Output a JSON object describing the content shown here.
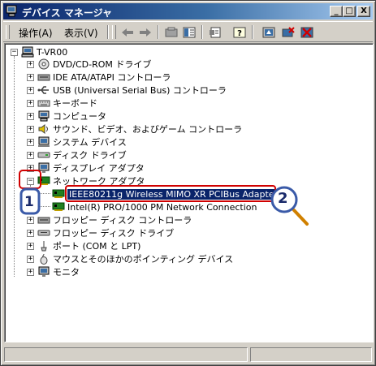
{
  "window": {
    "title": "デバイス マネージャ"
  },
  "title_buttons": {
    "minimize": "_",
    "maximize": "□",
    "close": "X"
  },
  "menu": {
    "action": "操作(A)",
    "view": "表示(V)"
  },
  "toolbar": [
    "back-icon",
    "forward-icon",
    "scan-icon",
    "properties-icon",
    "print-icon",
    "help-icon",
    "update-driver-icon",
    "uninstall-icon",
    "disable-icon"
  ],
  "tree": {
    "root": "T-VR00",
    "items": [
      "DVD/CD-ROM ドライブ",
      "IDE ATA/ATAPI コントローラ",
      "USB (Universal Serial Bus) コントローラ",
      "キーボード",
      "コンピュータ",
      "サウンド、ビデオ、およびゲーム コントローラ",
      "システム デバイス",
      "ディスク ドライブ",
      "ディスプレイ アダプタ",
      "ネットワーク アダプタ"
    ],
    "network_children": [
      "IEEE80211g Wireless MIMO XR PCIBus Adapter",
      "Intel(R) PRO/1000 PM Network Connection"
    ],
    "after_items": [
      "フロッピー ディスク コントローラ",
      "フロッピー ディスク ドライブ",
      "ポート (COM と LPT)",
      "マウスとそのほかのポインティング デバイス",
      "モニタ"
    ]
  },
  "annotations": {
    "step1": "1",
    "step2": "2"
  },
  "colors": {
    "highlight_red": "#d00000",
    "badge_blue": "#3a5aa8",
    "selection": "#0a246a"
  }
}
